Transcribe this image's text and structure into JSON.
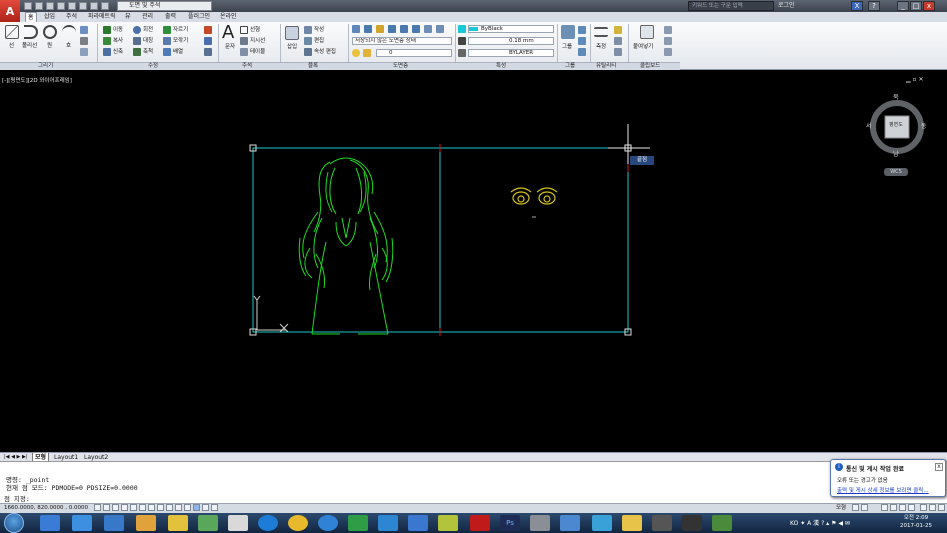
{
  "app": {
    "qa_drop": "도면 및 주석",
    "search_placeholder": "키워드 또는 구문 입력",
    "signin": "로그인"
  },
  "tabs": [
    "홈",
    "삽입",
    "주석",
    "파라메트릭",
    "뷰",
    "관리",
    "출력",
    "플러그인",
    "온라인"
  ],
  "ribbon": {
    "draw": {
      "line": "선",
      "polyline": "폴리선",
      "circle": "원",
      "arc": "호"
    },
    "modify": {
      "move": "이동",
      "rotate": "회전",
      "trim": "자르기",
      "copy": "복사",
      "mirror": "대칭",
      "fillet": "모깎기",
      "stretch": "신축",
      "scale": "축척",
      "array": "배열"
    },
    "annotation": {
      "text": "문자",
      "dimension": "선형",
      "leader": "지시선",
      "table": "테이블"
    },
    "block": {
      "insert": "삽입",
      "create": "작성",
      "edit": "편집",
      "edit_attr": "속성 편집"
    },
    "layer": {
      "state": "저장되지 않은 도면층 상태",
      "current": "0"
    },
    "properties": {
      "color": "ByBlack",
      "lineweight": "0.18 mm",
      "linetype": "BYLAYER"
    },
    "groups": {
      "group": "그룹"
    },
    "utilities": {
      "measure": "측정"
    },
    "clipboard": {
      "paste": "붙여넣기"
    }
  },
  "panels": [
    "그리기",
    "수정",
    "주석",
    "블록",
    "도면층",
    "특성",
    "그룹",
    "유틸리티",
    "클립보드"
  ],
  "viewport": {
    "label": "[-][평면도][2D 와이어프레임]",
    "controls": "▁ ▫ ✕",
    "snap_tooltip": "끝점",
    "wcs": "WCS"
  },
  "viewcube": {
    "north": "북",
    "south": "남",
    "east": "동",
    "west": "서",
    "face": "평면도"
  },
  "layout_tabs": [
    "모형",
    "Layout1",
    "Layout2"
  ],
  "command": {
    "line1": "명령:  _point",
    "line2": "현재 점 모드:  PDMODE=0  PDSIZE=0.0000",
    "line3": "점 지정:"
  },
  "status": {
    "coords": "1660.0000, 820.0000 , 0.0000",
    "model": "모형"
  },
  "balloon": {
    "title": "통신 및 게시 작업 완료",
    "text": "오류 또는 경고가 없음",
    "link": "출력 및 게시 상세 정보를 보려면 클릭..."
  },
  "clock": {
    "time": "오전 2:09",
    "date": "2017-01-25"
  },
  "colors": {
    "drawing": "#1fdc1f",
    "border": "#1fc9c9",
    "accent": "#c01a1a",
    "eyes": "#d4c21a"
  }
}
